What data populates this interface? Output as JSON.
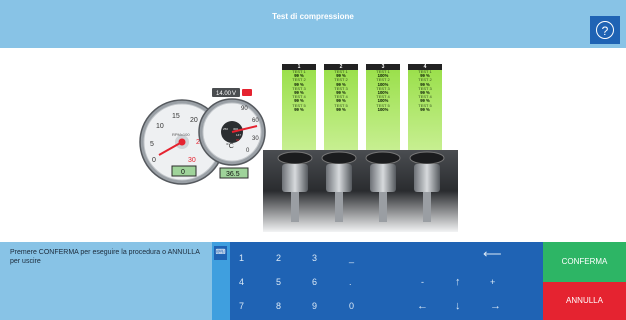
{
  "header": {
    "title": "Test di compressione",
    "help_icon": "question-mark-icon",
    "help_symbol": "?"
  },
  "gauges": {
    "rpm": {
      "unit": "RPMx100",
      "ticks": [
        "5",
        "10",
        "15",
        "20",
        "25",
        "30",
        "0"
      ],
      "readout": "0"
    },
    "temp": {
      "readout": "36.5",
      "unit": "°C",
      "ticks": [
        "90",
        "60",
        "30",
        "0"
      ],
      "small": [
        "250",
        "300",
        "147",
        "85"
      ]
    },
    "battery": {
      "value": "14.00",
      "unit": "V"
    }
  },
  "cylinders": [
    {
      "label": "1",
      "tests": [
        {
          "name": "TEST 1",
          "value": "99 %"
        },
        {
          "name": "TEST 2",
          "value": "99 %"
        },
        {
          "name": "TEST 3",
          "value": "99 %"
        },
        {
          "name": "TEST 4",
          "value": "99 %"
        },
        {
          "name": "TEST 5",
          "value": "99 %"
        }
      ]
    },
    {
      "label": "2",
      "tests": [
        {
          "name": "TEST 1",
          "value": "99 %"
        },
        {
          "name": "TEST 2",
          "value": "99 %"
        },
        {
          "name": "TEST 3",
          "value": "99 %"
        },
        {
          "name": "TEST 4",
          "value": "99 %"
        },
        {
          "name": "TEST 5",
          "value": "99 %"
        }
      ]
    },
    {
      "label": "3",
      "tests": [
        {
          "name": "TEST 1",
          "value": "100%"
        },
        {
          "name": "TEST 2",
          "value": "100%"
        },
        {
          "name": "TEST 3",
          "value": "100%"
        },
        {
          "name": "TEST 4",
          "value": "100%"
        },
        {
          "name": "TEST 5",
          "value": "100%"
        }
      ]
    },
    {
      "label": "4",
      "tests": [
        {
          "name": "TEST 1",
          "value": "99 %"
        },
        {
          "name": "TEST 2",
          "value": "99 %"
        },
        {
          "name": "TEST 3",
          "value": "99 %"
        },
        {
          "name": "TEST 4",
          "value": "99 %"
        },
        {
          "name": "TEST 5",
          "value": "99 %"
        }
      ]
    }
  ],
  "footer": {
    "message": "Premere CONFERMA per eseguire la procedura o ANNULLA per uscire",
    "keyboard_icon": "keyboard-icon",
    "keys": {
      "k1": "1",
      "k2": "2",
      "k3": "3",
      "k_minus": "_",
      "k_back": "⟵",
      "k4": "4",
      "k5": "5",
      "k6": "6",
      "k_dot": ".",
      "k_dash": "-",
      "k_up": "↑",
      "k_plus": "+",
      "k7": "7",
      "k8": "8",
      "k9": "9",
      "k0": "0",
      "k_left": "←",
      "k_down": "↓",
      "k_right": "→"
    },
    "confirm": "CONFERMA",
    "cancel": "ANNULLA"
  },
  "colors": {
    "header": "#88c3e6",
    "keypad": "#1f63b4",
    "confirm": "#2db565",
    "cancel": "#e52330",
    "bar": "#9be04c"
  }
}
